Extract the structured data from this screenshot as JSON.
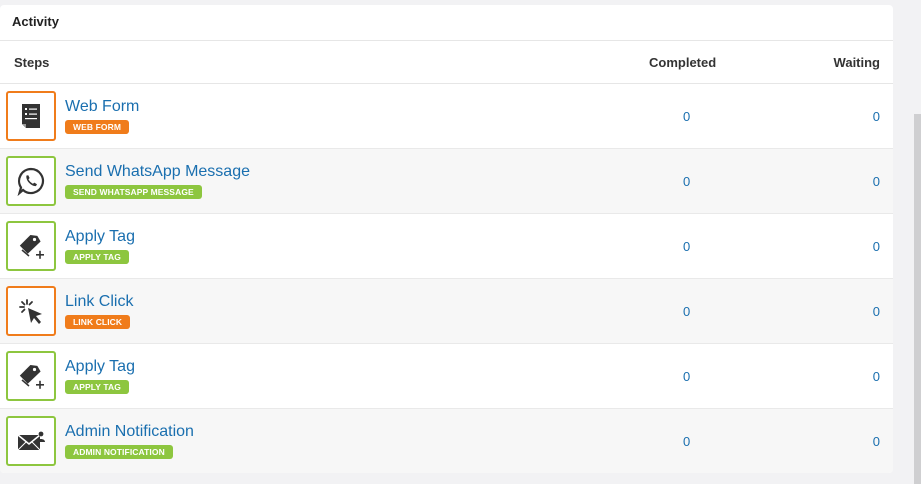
{
  "panel": {
    "title": "Activity"
  },
  "columns": {
    "steps": "Steps",
    "completed": "Completed",
    "waiting": "Waiting"
  },
  "rows": [
    {
      "title": "Web Form",
      "badge": "WEB FORM",
      "color": "orange",
      "icon": "web-form-icon",
      "completed": "0",
      "waiting": "0"
    },
    {
      "title": "Send WhatsApp Message",
      "badge": "SEND WHATSAPP MESSAGE",
      "color": "green",
      "icon": "whatsapp-icon",
      "completed": "0",
      "waiting": "0"
    },
    {
      "title": "Apply Tag",
      "badge": "APPLY TAG",
      "color": "green",
      "icon": "apply-tag-icon",
      "completed": "0",
      "waiting": "0"
    },
    {
      "title": "Link Click",
      "badge": "LINK CLICK",
      "color": "orange",
      "icon": "link-click-icon",
      "completed": "0",
      "waiting": "0"
    },
    {
      "title": "Apply Tag",
      "badge": "APPLY TAG",
      "color": "green",
      "icon": "apply-tag-icon",
      "completed": "0",
      "waiting": "0"
    },
    {
      "title": "Admin Notification",
      "badge": "ADMIN NOTIFICATION",
      "color": "green",
      "icon": "admin-notification-icon",
      "completed": "0",
      "waiting": "0"
    }
  ],
  "colors": {
    "green": "#8dc63f",
    "orange": "#f07c1b",
    "link": "#1a6faf"
  }
}
